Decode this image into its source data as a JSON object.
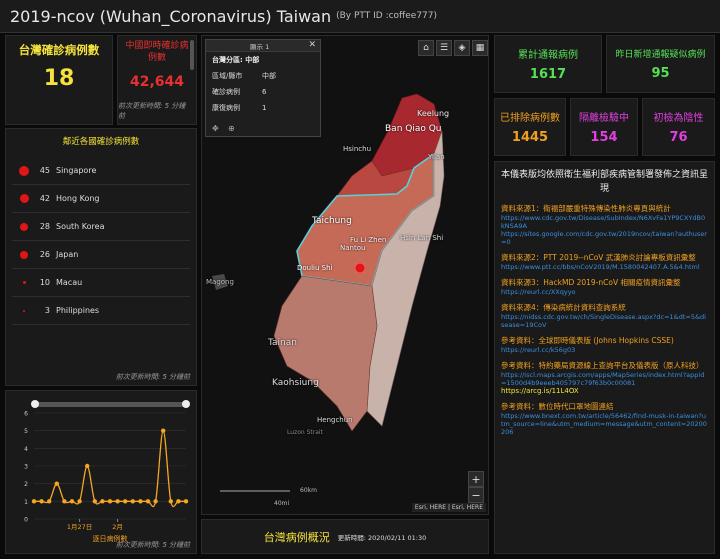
{
  "header": {
    "title": "2019-ncov (Wuhan_Coronavirus) Taiwan",
    "subtitle": "(By PTT ID :coffee777)"
  },
  "taiwan_confirmed": {
    "label": "台灣確診病例數",
    "value": "18"
  },
  "china_confirmed": {
    "label": "中國即時確診病例數",
    "value": "42,644",
    "note": "前次更新時間: 5 分鐘前"
  },
  "nearby": {
    "title": "鄰近各國確診病例數",
    "note": "前次更新時間: 5 分鐘前",
    "items": [
      {
        "count": "45",
        "name": "Singapore",
        "dot": 10
      },
      {
        "count": "42",
        "name": "Hong Kong",
        "dot": 9
      },
      {
        "count": "28",
        "name": "South Korea",
        "dot": 8
      },
      {
        "count": "26",
        "name": "Japan",
        "dot": 8
      },
      {
        "count": "10",
        "name": "Macau",
        "dot": 3
      },
      {
        "count": "3",
        "name": "Philippines",
        "dot": 2
      }
    ]
  },
  "chart_data": {
    "type": "line",
    "x": [
      "1/21",
      "1/22",
      "1/23",
      "1/24",
      "1/25",
      "1/26",
      "1/27",
      "1/28",
      "1/29",
      "1/30",
      "1/31",
      "2/1",
      "2/2",
      "2/3",
      "2/4",
      "2/5",
      "2/6",
      "2/7",
      "2/8",
      "2/9",
      "2/10"
    ],
    "values": [
      1,
      1,
      1,
      2,
      1,
      1,
      1,
      3,
      1,
      1,
      1,
      1,
      1,
      1,
      1,
      1,
      1,
      5,
      1,
      1,
      1
    ],
    "ylim": [
      0,
      6
    ],
    "yticks": [
      "0",
      "1",
      "2",
      "3",
      "4",
      "5",
      "6"
    ],
    "xticks": [
      "1月27日",
      "2月"
    ],
    "xlabel": "逐日病例數",
    "color": "#f5a623",
    "grid": true
  },
  "chart": {
    "xlabel": "逐日病例數",
    "note": "前次更新時間: 5 分鐘前"
  },
  "map": {
    "popup": {
      "tab": "顯示 1",
      "title": "台灣分區: 中部",
      "rows": [
        {
          "k": "區域/縣市",
          "v": "中部"
        },
        {
          "k": "確診病例",
          "v": "6"
        },
        {
          "k": "康復病例",
          "v": "1"
        }
      ]
    },
    "labels": [
      "Keelung",
      "Ban Qiao Qu",
      "Hsinchu",
      "Yilan",
      "Taichung",
      "Fu Li Zhen",
      "Nantou",
      "Hsin Lan Shi",
      "Douliu Shi",
      "Magong",
      "Tainan",
      "Kaohsiung",
      "Luzon Strait",
      "Hengchun"
    ],
    "scale": {
      "km": "60km",
      "mi": "40mi"
    },
    "attribution": "Esri, HERE | Esri, HERE"
  },
  "bottom_title": {
    "label": "台灣病例概況",
    "update": "更新時間: 2020/02/11 01:30"
  },
  "stats": [
    {
      "label": "累計通報病例",
      "value": "1617",
      "color": "#55e055"
    },
    {
      "label": "昨日新增通報疑似病例",
      "value": "95",
      "color": "#55e055"
    },
    {
      "label": "已排除病例數",
      "value": "1445",
      "color": "#f0a020"
    },
    {
      "label": "隔離檢驗中",
      "value": "154",
      "color": "#e040e0"
    },
    {
      "label": "初檢為陰性",
      "value": "76",
      "color": "#e040e0"
    }
  ],
  "info": {
    "heading": "本儀表版均依照衛生福利部疾病管制署發佈之資訊呈現",
    "sources": [
      {
        "title": "資料來源1：衛福部嚴重特殊傳染性肺炎專頁與統計",
        "links": [
          "https://www.cdc.gov.tw/Disease/SubIndex/N6XvFa1YP9CXYdB0kNSA9A",
          "https://sites.google.com/cdc.gov.tw/2019ncov/taiwan?authuser=0"
        ]
      },
      {
        "title": "資料來源2：PTT 2019--nCoV 武漢肺炎討論專板資訊彙整",
        "links": [
          "https://www.ptt.cc/bbs/nCoV2019/M.1580042407.A.5&4.html"
        ]
      },
      {
        "title": "資料來源3：HackMD 2019-nCoV 相關疫情資訊彙整",
        "links": [
          "https://reurl.cc/XXqyyo"
        ]
      },
      {
        "title": "資料來源4：傳染病統計資料查詢系統",
        "links": [
          "https://nidss.cdc.gov.tw/ch/SingleDisease.aspx?dc=1&dt=5&disease=19CoV"
        ]
      },
      {
        "title": "參考資料：全球即時儀表版 (Johns Hopkins CSSE)",
        "links": [
          "https://reurl.cc/k56g03"
        ]
      },
      {
        "title": "參考資料：特約藥局資源線上查詢平台及儀表版（原人科技）",
        "links": [
          "https://iscl.maps.arcgis.com/apps/MapSeries/index.html?appid=1500d4b9eeeb405797c79f63b0c00081",
          "https://arcg.is/11L4OX"
        ]
      },
      {
        "title": "參考資料：數位時代口罩地圖連結",
        "links": [
          "https://www.bnext.com.tw/article/56462/find-musk-in-taiwan?utm_source=line&utm_medium=message&utm_content=20200206"
        ]
      }
    ]
  }
}
